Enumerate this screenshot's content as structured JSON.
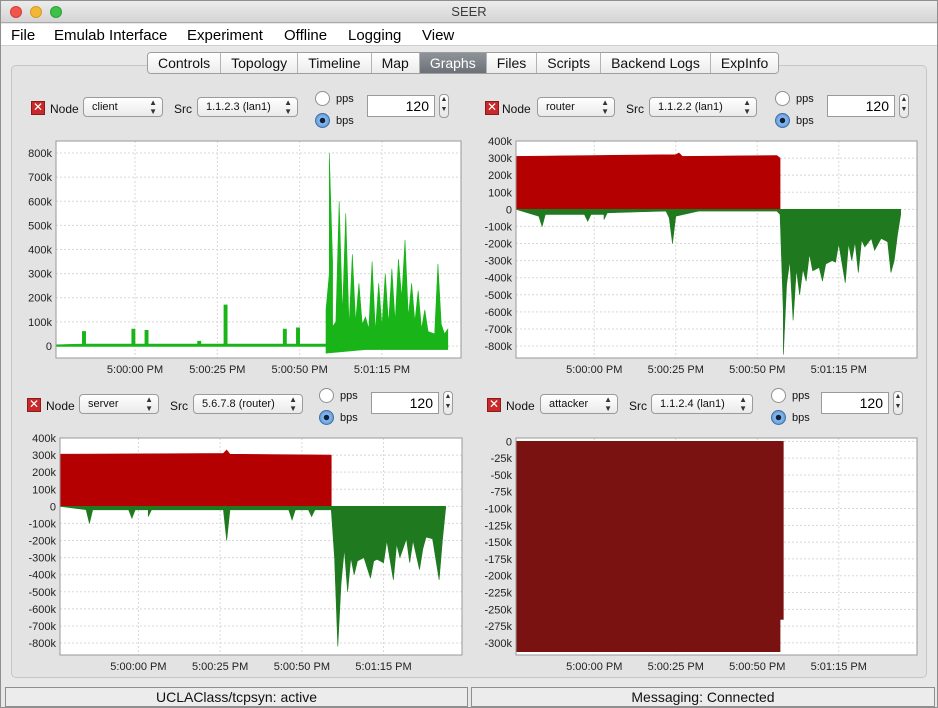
{
  "window": {
    "title": "SEER"
  },
  "menu": [
    "File",
    "Emulab Interface",
    "Experiment",
    "Offline",
    "Logging",
    "View"
  ],
  "tabs": [
    {
      "label": "Controls",
      "active": false
    },
    {
      "label": "Topology",
      "active": false
    },
    {
      "label": "Timeline",
      "active": false
    },
    {
      "label": "Map",
      "active": false
    },
    {
      "label": "Graphs",
      "active": true
    },
    {
      "label": "Files",
      "active": false
    },
    {
      "label": "Scripts",
      "active": false
    },
    {
      "label": "Backend Logs",
      "active": false
    },
    {
      "label": "ExpInfo",
      "active": false
    }
  ],
  "panels": [
    {
      "node_label": "Node",
      "node": "client",
      "src_label": "Src",
      "src": "1.1.2.3 (lan1)",
      "pps_label": "pps",
      "bps_label": "bps",
      "selected_unit": "bps",
      "interval": "120"
    },
    {
      "node_label": "Node",
      "node": "router",
      "src_label": "Src",
      "src": "1.1.2.2 (lan1)",
      "pps_label": "pps",
      "bps_label": "bps",
      "selected_unit": "bps",
      "interval": "120"
    },
    {
      "node_label": "Node",
      "node": "server",
      "src_label": "Src",
      "src": "5.6.7.8 (router)",
      "pps_label": "pps",
      "bps_label": "bps",
      "selected_unit": "bps",
      "interval": "120"
    },
    {
      "node_label": "Node",
      "node": "attacker",
      "src_label": "Src",
      "src": "1.1.2.4 (lan1)",
      "pps_label": "pps",
      "bps_label": "bps",
      "selected_unit": "bps",
      "interval": "120"
    }
  ],
  "status": {
    "left": "UCLAClass/tcpsyn: active",
    "right": "Messaging: Connected"
  },
  "colors": {
    "green": "#18b418",
    "dark_green": "#1f7a1f",
    "red": "#b40000",
    "dark_red": "#7a1212",
    "grid": "#d8d8d8"
  },
  "chart_data": [
    {
      "type": "area",
      "node": "client",
      "x_ticks": [
        "5:00:00 PM",
        "5:00:25 PM",
        "5:00:50 PM",
        "5:01:15 PM"
      ],
      "x_tick_seconds": [
        0,
        25,
        50,
        75
      ],
      "xlim": [
        -24,
        99
      ],
      "ylim": [
        -50000,
        850000
      ],
      "y_ticks": [
        0,
        100000,
        200000,
        300000,
        400000,
        500000,
        600000,
        700000,
        800000
      ],
      "y_tick_labels": [
        "0",
        "100k",
        "200k",
        "300k",
        "400k",
        "500k",
        "600k",
        "700k",
        "800k"
      ],
      "series": [
        {
          "sign": "positive",
          "color": "#18b418",
          "points": [
            [
              -24,
              5000
            ],
            [
              -16,
              8000
            ],
            [
              -16,
              60000
            ],
            [
              -15,
              60000
            ],
            [
              -15,
              8000
            ],
            [
              -1,
              8000
            ],
            [
              -1,
              70000
            ],
            [
              0,
              70000
            ],
            [
              0,
              8000
            ],
            [
              3,
              8000
            ],
            [
              3,
              65000
            ],
            [
              4,
              65000
            ],
            [
              4,
              8000
            ],
            [
              19,
              8000
            ],
            [
              19,
              20000
            ],
            [
              20,
              20000
            ],
            [
              20,
              8000
            ],
            [
              27,
              8000
            ],
            [
              27,
              170000
            ],
            [
              28,
              170000
            ],
            [
              28,
              8000
            ],
            [
              45,
              8000
            ],
            [
              45,
              70000
            ],
            [
              46,
              70000
            ],
            [
              46,
              8000
            ],
            [
              49,
              8000
            ],
            [
              49,
              75000
            ],
            [
              50,
              75000
            ],
            [
              50,
              8000
            ],
            [
              58,
              8000
            ],
            [
              58,
              150000
            ],
            [
              59,
              300000
            ],
            [
              59,
              800000
            ],
            [
              60,
              350000
            ],
            [
              60,
              80000
            ],
            [
              61,
              100000
            ],
            [
              62,
              600000
            ],
            [
              63,
              130000
            ],
            [
              64,
              550000
            ],
            [
              65,
              80000
            ],
            [
              66,
              380000
            ],
            [
              67,
              100000
            ],
            [
              68,
              260000
            ],
            [
              69,
              90000
            ],
            [
              70,
              120000
            ],
            [
              71,
              70000
            ],
            [
              72,
              350000
            ],
            [
              73,
              60000
            ],
            [
              74,
              260000
            ],
            [
              75,
              80000
            ],
            [
              76,
              300000
            ],
            [
              77,
              90000
            ],
            [
              78,
              320000
            ],
            [
              79,
              100000
            ],
            [
              80,
              360000
            ],
            [
              81,
              200000
            ],
            [
              82,
              440000
            ],
            [
              83,
              120000
            ],
            [
              84,
              260000
            ],
            [
              85,
              100000
            ],
            [
              86,
              230000
            ],
            [
              87,
              70000
            ],
            [
              88,
              150000
            ],
            [
              89,
              60000
            ],
            [
              91,
              50000
            ],
            [
              92,
              340000
            ],
            [
              93,
              90000
            ],
            [
              94,
              50000
            ],
            [
              95,
              70000
            ],
            [
              95,
              10000
            ]
          ]
        },
        {
          "sign": "negative",
          "color": "#18b418",
          "points": [
            [
              -24,
              -2000
            ],
            [
              58,
              -2000
            ],
            [
              58,
              -30000
            ],
            [
              70,
              -15000
            ],
            [
              95,
              -15000
            ],
            [
              95,
              -2000
            ]
          ]
        }
      ]
    },
    {
      "type": "area",
      "node": "router",
      "x_ticks": [
        "5:00:00 PM",
        "5:00:25 PM",
        "5:00:50 PM",
        "5:01:15 PM"
      ],
      "x_tick_seconds": [
        0,
        25,
        50,
        75
      ],
      "xlim": [
        -24,
        99
      ],
      "ylim": [
        -870000,
        400000
      ],
      "y_ticks": [
        400000,
        300000,
        200000,
        100000,
        0,
        -100000,
        -200000,
        -300000,
        -400000,
        -500000,
        -600000,
        -700000,
        -800000
      ],
      "y_tick_labels": [
        "400k",
        "300k",
        "200k",
        "100k",
        "0",
        "-100k",
        "-200k",
        "-300k",
        "-400k",
        "-500k",
        "-600k",
        "-700k",
        "-800k"
      ],
      "series": [
        {
          "sign": "positive",
          "color": "#b40000",
          "points": [
            [
              -24,
              310000
            ],
            [
              25,
              320000
            ],
            [
              26,
              330000
            ],
            [
              27,
              310000
            ],
            [
              56,
              315000
            ],
            [
              57,
              300000
            ],
            [
              57,
              0
            ]
          ]
        },
        {
          "sign": "negative",
          "color": "#1f7a1f",
          "points": [
            [
              -24,
              0
            ],
            [
              -17,
              -40000
            ],
            [
              -16,
              -100000
            ],
            [
              -15,
              -30000
            ],
            [
              -3,
              -30000
            ],
            [
              -2,
              -70000
            ],
            [
              -1,
              -30000
            ],
            [
              3,
              -30000
            ],
            [
              3,
              -60000
            ],
            [
              4,
              -20000
            ],
            [
              22,
              -10000
            ],
            [
              23,
              -50000
            ],
            [
              24,
              -200000
            ],
            [
              25,
              -40000
            ],
            [
              32,
              -10000
            ],
            [
              56,
              -10000
            ],
            [
              57,
              -30000
            ],
            [
              58,
              -600000
            ],
            [
              58,
              -850000
            ],
            [
              59,
              -440000
            ],
            [
              60,
              -300000
            ],
            [
              61,
              -650000
            ],
            [
              62,
              -350000
            ],
            [
              63,
              -500000
            ],
            [
              64,
              -350000
            ],
            [
              65,
              -420000
            ],
            [
              66,
              -260000
            ],
            [
              67,
              -360000
            ],
            [
              69,
              -340000
            ],
            [
              70,
              -420000
            ],
            [
              71,
              -320000
            ],
            [
              73,
              -300000
            ],
            [
              74,
              -310000
            ],
            [
              75,
              -200000
            ],
            [
              77,
              -430000
            ],
            [
              78,
              -200000
            ],
            [
              79,
              -300000
            ],
            [
              80,
              -190000
            ],
            [
              81,
              -370000
            ],
            [
              82,
              -180000
            ],
            [
              83,
              -220000
            ],
            [
              85,
              -170000
            ],
            [
              86,
              -240000
            ],
            [
              88,
              -170000
            ],
            [
              90,
              -190000
            ],
            [
              91,
              -370000
            ],
            [
              92,
              -300000
            ],
            [
              93,
              -150000
            ],
            [
              94,
              -30000
            ],
            [
              94,
              0
            ]
          ]
        }
      ]
    },
    {
      "type": "area",
      "node": "server",
      "x_ticks": [
        "5:00:00 PM",
        "5:00:25 PM",
        "5:00:50 PM",
        "5:01:15 PM"
      ],
      "x_tick_seconds": [
        0,
        25,
        50,
        75
      ],
      "xlim": [
        -24,
        99
      ],
      "ylim": [
        -870000,
        400000
      ],
      "y_ticks": [
        400000,
        300000,
        200000,
        100000,
        0,
        -100000,
        -200000,
        -300000,
        -400000,
        -500000,
        -600000,
        -700000,
        -800000
      ],
      "y_tick_labels": [
        "400k",
        "300k",
        "200k",
        "100k",
        "0",
        "-100k",
        "-200k",
        "-300k",
        "-400k",
        "-500k",
        "-600k",
        "-700k",
        "-800k"
      ],
      "series": [
        {
          "sign": "positive",
          "color": "#b40000",
          "points": [
            [
              -24,
              305000
            ],
            [
              26,
              310000
            ],
            [
              27,
              330000
            ],
            [
              28,
              305000
            ],
            [
              59,
              300000
            ],
            [
              59,
              0
            ]
          ]
        },
        {
          "sign": "negative",
          "color": "#1f7a1f",
          "points": [
            [
              -24,
              0
            ],
            [
              -16,
              -20000
            ],
            [
              -15,
              -100000
            ],
            [
              -14,
              -20000
            ],
            [
              -3,
              -20000
            ],
            [
              -2,
              -70000
            ],
            [
              -1,
              -20000
            ],
            [
              3,
              -20000
            ],
            [
              3,
              -60000
            ],
            [
              4,
              -20000
            ],
            [
              26,
              -20000
            ],
            [
              27,
              -200000
            ],
            [
              28,
              -20000
            ],
            [
              46,
              -20000
            ],
            [
              47,
              -80000
            ],
            [
              48,
              -20000
            ],
            [
              52,
              -20000
            ],
            [
              53,
              -60000
            ],
            [
              54,
              -20000
            ],
            [
              59,
              -20000
            ],
            [
              60,
              -300000
            ],
            [
              61,
              -820000
            ],
            [
              62,
              -450000
            ],
            [
              63,
              -250000
            ],
            [
              64,
              -500000
            ],
            [
              65,
              -300000
            ],
            [
              66,
              -400000
            ],
            [
              67,
              -320000
            ],
            [
              69,
              -300000
            ],
            [
              71,
              -420000
            ],
            [
              72,
              -320000
            ],
            [
              73,
              -310000
            ],
            [
              75,
              -330000
            ],
            [
              76,
              -200000
            ],
            [
              78,
              -430000
            ],
            [
              79,
              -220000
            ],
            [
              80,
              -300000
            ],
            [
              82,
              -190000
            ],
            [
              83,
              -330000
            ],
            [
              84,
              -200000
            ],
            [
              86,
              -370000
            ],
            [
              87,
              -250000
            ],
            [
              88,
              -180000
            ],
            [
              90,
              -190000
            ],
            [
              92,
              -430000
            ],
            [
              93,
              -200000
            ],
            [
              94,
              -10000
            ],
            [
              94,
              0
            ]
          ]
        }
      ]
    },
    {
      "type": "area",
      "node": "attacker",
      "x_ticks": [
        "5:00:00 PM",
        "5:00:25 PM",
        "5:00:50 PM",
        "5:01:15 PM"
      ],
      "x_tick_seconds": [
        0,
        25,
        50,
        75
      ],
      "xlim": [
        -24,
        99
      ],
      "ylim": [
        -318000,
        5000
      ],
      "y_ticks": [
        0,
        -25000,
        -50000,
        -75000,
        -100000,
        -125000,
        -150000,
        -175000,
        -200000,
        -225000,
        -250000,
        -275000,
        -300000
      ],
      "y_tick_labels": [
        "0",
        "-25k",
        "-50k",
        "-75k",
        "-100k",
        "-125k",
        "-150k",
        "-175k",
        "-200k",
        "-225k",
        "-250k",
        "-275k",
        "-300k"
      ],
      "series": [
        {
          "sign": "negative",
          "color": "#7a1212",
          "points": [
            [
              -24,
              0
            ],
            [
              58,
              0
            ],
            [
              58,
              -265000
            ],
            [
              57,
              -265000
            ],
            [
              57,
              -313000
            ],
            [
              -24,
              -313000
            ]
          ]
        }
      ]
    }
  ]
}
